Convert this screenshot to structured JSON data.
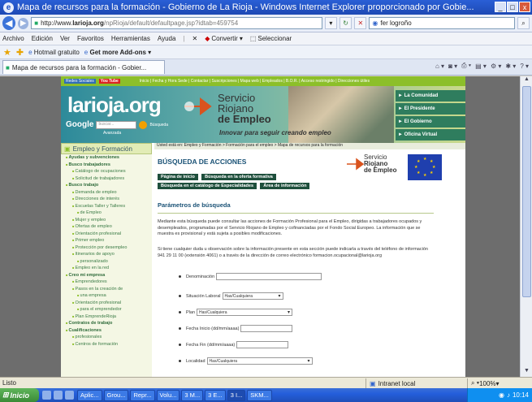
{
  "window": {
    "title": "Mapa de recursos para la formación - Gobierno de La Rioja - Windows Internet Explorer proporcionado por Gobie...",
    "controls": [
      "_",
      "□",
      "x"
    ]
  },
  "address": {
    "url_prefix": "http://www.",
    "url_host": "larioja.org",
    "url_rest": "/npRioja/default/defaultpage.jsp?idtab=459754",
    "search_value": "fer logroño"
  },
  "menu": {
    "items": [
      "Archivo",
      "Edición",
      "Ver",
      "Favoritos",
      "Herramientas",
      "Ayuda"
    ],
    "convert": "Convertir",
    "select": "Seleccionar"
  },
  "favorites": {
    "hotmail": "Hotmail gratuito",
    "addons": "Get more Add-ons"
  },
  "tab": {
    "label": "Mapa de recursos para la formación - Gobier..."
  },
  "site": {
    "topstrip": {
      "badge": "Redes Sociales",
      "yt": "You Tube",
      "links": "Inicio | Fecha y Hora Sede | Contactar | Suscripciones | Mapa web | Empleados | B.O.R. | Acceso restringido | Direcciones útiles"
    },
    "logo": "larioja.org",
    "servicio": [
      "Servicio",
      "Riojano",
      "de Empleo"
    ],
    "slogan": "Innovar para seguir creando empleo",
    "google": {
      "label": "Google",
      "placeholder": "buscar...",
      "search": "Búsqueda",
      "advanced": "Avanzada"
    },
    "header_nav": [
      "► La Comunidad",
      "► El Presidente",
      "► El Gobierno",
      "► Oficina Virtual"
    ],
    "breadcrumb": "Usted está en: Empleo y Formación > Formación para el empleo > Mapa de recursos para la formación"
  },
  "leftnav": {
    "head": "Empleo y Formación",
    "items": [
      {
        "label": "Ayudas y subvenciones",
        "level": 0
      },
      {
        "label": "Busco trabajadores",
        "level": 0
      },
      {
        "label": "Catálogo de ocupaciones",
        "level": 1
      },
      {
        "label": "Solicitud de trabajadores",
        "level": 1
      },
      {
        "label": "Busco trabajo",
        "level": 0
      },
      {
        "label": "Demanda de empleo",
        "level": 1
      },
      {
        "label": "Direcciones de interés",
        "level": 1
      },
      {
        "label": "Escuelas Taller y Talleres",
        "level": 1
      },
      {
        "label": "de Empleo",
        "level": 2
      },
      {
        "label": "Mujer y empleo",
        "level": 1
      },
      {
        "label": "Ofertas de empleo",
        "level": 1
      },
      {
        "label": "Orientación profesional",
        "level": 1
      },
      {
        "label": "Primer empleo",
        "level": 1
      },
      {
        "label": "Protección por desempleo",
        "level": 1
      },
      {
        "label": "Itinerarios de apoyo",
        "level": 1
      },
      {
        "label": "personalizado",
        "level": 2
      },
      {
        "label": "Empleo en la red",
        "level": 1
      },
      {
        "label": "Creo mi empresa",
        "level": 0
      },
      {
        "label": "Emprendedores",
        "level": 1
      },
      {
        "label": "Pasos en la creación de",
        "level": 1
      },
      {
        "label": "una empresa",
        "level": 2
      },
      {
        "label": "Orientación profesional",
        "level": 1
      },
      {
        "label": "para el emprendedor",
        "level": 2
      },
      {
        "label": "Plan EmprendeRioja",
        "level": 1
      },
      {
        "label": "Contratos de trabajo",
        "level": 0
      },
      {
        "label": "Cualificaciones",
        "level": 0
      },
      {
        "label": "profesionales",
        "level": 1
      },
      {
        "label": "Centros de formación",
        "level": 1
      }
    ]
  },
  "content": {
    "title": "BÚSQUEDA DE ACCIONES",
    "logo_text": [
      "Servicio",
      "Riojano",
      "de Empleo"
    ],
    "buttons": [
      "Página de inicio",
      "Búsqueda en la oferta formativa",
      "Búsqueda en el catálogo de Especialidades",
      "Área de información"
    ],
    "section": "Parámetros de búsqueda",
    "para1": "Mediante esta búsqueda puede consultar las acciones de Formación Profesional para el Empleo, dirigidas a trabajadores ocupados y desempleados, programadas por el Servicio Riojano de Empleo y cofinanciadas por el Fondo Social Europeo. La información que se muestra es provisional y está sujeta a posibles modificaciones.",
    "para2": "Si tiene cualquier duda u observación sobre la información presente en esta sección puede indicarla a través del teléfono de información 941 29 11 00 (extensión 4061) o a través de la dirección de correo electrónico formacion.ocupacional@larioja.org",
    "form": {
      "denominacion": "Denominación",
      "situacion": "Situación Laboral",
      "situacion_value": "Has/Cualquiera",
      "plan": "Plan",
      "plan_value": "Has/Cualquiera",
      "fecha_inicio": "Fecha Inicio (dd/mm/aaaa)",
      "fecha_fin": "Fecha Fin (dd/mm/aaaa)",
      "localidad": "Localidad",
      "localidad_value": "Has/Cualquiera"
    }
  },
  "status": {
    "left": "Listo",
    "zone": "Intranet local",
    "zoom": "100%"
  },
  "taskbar": {
    "start": "Inicio",
    "items": [
      "Aplic...",
      "Grou...",
      "Repr...",
      "Volu...",
      "3 M...",
      "3 E...",
      "3 I...",
      "SKM..."
    ],
    "clock": "10:14"
  }
}
